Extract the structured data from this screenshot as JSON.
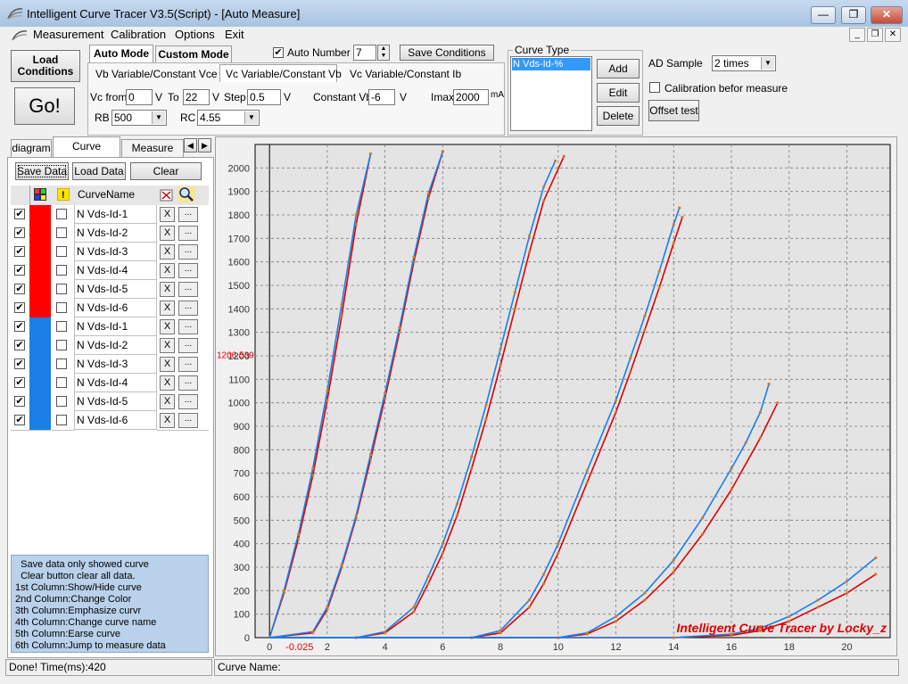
{
  "window": {
    "title": "Intelligent Curve Tracer V3.5(Script) - [Auto Measure]",
    "minimize": "—",
    "restore": "❐",
    "close": "✕"
  },
  "menu": {
    "items": [
      "Measurement",
      "Calibration",
      "Options",
      "Exit"
    ]
  },
  "toolbar": {
    "load_conditions": "Load\nConditions",
    "go": "Go!",
    "auto_mode": "Auto Mode",
    "custom_mode": "Custom Mode",
    "auto_number_label": "Auto Number",
    "auto_number_checked": true,
    "auto_number_value": "7",
    "save_conditions": "Save Conditions",
    "mode_tabs": [
      "Vb Variable/Constant Vce",
      "Vc Variable/Constant Vb",
      "Vc Variable/Constant Ib"
    ],
    "vc_from_label": "Vc from",
    "vc_from": "0",
    "to_label": "To",
    "to_value": "22",
    "step_label": "Step",
    "step_value": "0.5",
    "unit_v": "V",
    "constant_vb_label": "Constant Vb",
    "constant_vb": "-6",
    "imax_label": "Imax",
    "imax_value": "2000",
    "unit_ma": "mA",
    "rb_label": "RB",
    "rb_value": "500",
    "rc_label": "RC",
    "rc_value": "4.55"
  },
  "curve_type": {
    "group_label": "Curve Type",
    "items": [
      "N Vds-Id-%"
    ],
    "add": "Add",
    "edit": "Edit",
    "delete": "Delete"
  },
  "ad": {
    "label": "AD Sample",
    "value": "2 times",
    "calibration_label": "Calibration befor measure",
    "calibration_checked": false,
    "offset_test": "Offset test"
  },
  "left_tabs": [
    "diagram",
    "Curve Control",
    "Measure Data"
  ],
  "curve_control": {
    "save_data": "Save Data",
    "load_data": "Load Data",
    "clear": "Clear",
    "header_name": "CurveName",
    "rows": [
      {
        "name": "N Vds-Id-1",
        "color": "#ff0000",
        "shown": true
      },
      {
        "name": "N Vds-Id-2",
        "color": "#ff0000",
        "shown": true
      },
      {
        "name": "N Vds-Id-3",
        "color": "#ff0000",
        "shown": true
      },
      {
        "name": "N Vds-Id-4",
        "color": "#ff0000",
        "shown": true
      },
      {
        "name": "N Vds-Id-5",
        "color": "#ff0000",
        "shown": true
      },
      {
        "name": "N Vds-Id-6",
        "color": "#ff0000",
        "shown": true
      },
      {
        "name": "N Vds-Id-1",
        "color": "#1a7fe6",
        "shown": true
      },
      {
        "name": "N Vds-Id-2",
        "color": "#1a7fe6",
        "shown": true
      },
      {
        "name": "N Vds-Id-3",
        "color": "#1a7fe6",
        "shown": true
      },
      {
        "name": "N Vds-Id-4",
        "color": "#1a7fe6",
        "shown": true
      },
      {
        "name": "N Vds-Id-5",
        "color": "#1a7fe6",
        "shown": true
      },
      {
        "name": "N Vds-Id-6",
        "color": "#1a7fe6",
        "shown": true
      }
    ],
    "x_label": "X",
    "dots_label": "...",
    "help_lines": [
      "  Save data only showed curve",
      "  Clear button clear all data.",
      "1st Column:Show/Hide curve",
      "2nd Column:Change Color",
      "3th Column:Emphasize curvr",
      "4th Column:Change curve name",
      "5th Column:Earse curve",
      "6th Column:Jump to measure data"
    ]
  },
  "status": {
    "left": "Done!  Time(ms):420",
    "right": "Curve Name:"
  },
  "chart_data": {
    "type": "line",
    "xlim": [
      -0.5,
      21.5
    ],
    "ylim": [
      0,
      2100
    ],
    "xticks": [
      0,
      2,
      4,
      6,
      8,
      10,
      12,
      14,
      16,
      18,
      20
    ],
    "yticks": [
      0,
      100,
      200,
      300,
      400,
      500,
      600,
      700,
      800,
      900,
      1000,
      1100,
      1200,
      1300,
      1400,
      1500,
      1600,
      1700,
      1800,
      1900,
      2000
    ],
    "grid": true,
    "cursor_x_label": "-0.025",
    "cursor_y_label": "1206.539",
    "watermark": "Intelligent Curve Tracer by Locky_z",
    "series": [
      {
        "color": "#e00000",
        "x": [
          0,
          0.5,
          1,
          1.5,
          2,
          2.5,
          3,
          3.5
        ],
        "y": [
          0,
          190,
          420,
          690,
          1010,
          1370,
          1760,
          2060
        ]
      },
      {
        "color": "#e00000",
        "x": [
          0,
          1.5,
          2,
          2.5,
          3,
          3.5,
          4,
          4.5,
          5,
          5.5,
          6
        ],
        "y": [
          0,
          20,
          120,
          300,
          510,
          760,
          1020,
          1300,
          1600,
          1870,
          2070
        ]
      },
      {
        "color": "#e00000",
        "x": [
          0,
          3,
          4,
          5,
          5.5,
          6,
          6.5,
          7,
          7.5,
          8,
          8.5,
          9,
          9.5,
          10.2
        ],
        "y": [
          0,
          0,
          20,
          110,
          230,
          360,
          520,
          720,
          930,
          1160,
          1400,
          1640,
          1860,
          2050
        ]
      },
      {
        "color": "#e00000",
        "x": [
          0,
          7,
          8,
          9,
          9.5,
          10,
          11,
          12,
          12.5,
          13,
          13.5,
          14,
          14.3
        ],
        "y": [
          0,
          0,
          20,
          130,
          230,
          360,
          660,
          960,
          1130,
          1310,
          1490,
          1680,
          1790
        ]
      },
      {
        "color": "#e00000",
        "x": [
          0,
          10,
          11,
          12,
          13,
          14,
          15,
          16,
          17,
          17.6
        ],
        "y": [
          0,
          0,
          15,
          70,
          160,
          280,
          440,
          630,
          850,
          1000
        ]
      },
      {
        "color": "#e00000",
        "x": [
          0,
          14,
          16,
          17,
          18,
          19,
          20,
          21
        ],
        "y": [
          0,
          0,
          10,
          30,
          70,
          130,
          190,
          270
        ]
      },
      {
        "color": "#1a7fe6",
        "x": [
          0,
          0.5,
          1,
          1.5,
          2,
          2.5,
          3,
          3.5
        ],
        "y": [
          0,
          200,
          440,
          720,
          1050,
          1420,
          1800,
          2060
        ]
      },
      {
        "color": "#1a7fe6",
        "x": [
          0,
          1.5,
          2,
          2.5,
          3,
          3.5,
          4,
          4.5,
          5,
          5.5,
          6
        ],
        "y": [
          0,
          25,
          130,
          310,
          520,
          780,
          1040,
          1320,
          1620,
          1890,
          2070
        ]
      },
      {
        "color": "#1a7fe6",
        "x": [
          0,
          3,
          4,
          5,
          5.5,
          6,
          6.5,
          7,
          7.5,
          8,
          8.5,
          9,
          9.5,
          9.9
        ],
        "y": [
          0,
          0,
          25,
          130,
          260,
          400,
          570,
          770,
          990,
          1230,
          1470,
          1710,
          1920,
          2030
        ]
      },
      {
        "color": "#1a7fe6",
        "x": [
          0,
          7,
          8,
          9,
          9.5,
          10,
          11,
          12,
          12.5,
          13,
          13.5,
          14,
          14.2
        ],
        "y": [
          0,
          0,
          30,
          160,
          270,
          400,
          710,
          1010,
          1190,
          1370,
          1560,
          1760,
          1830
        ]
      },
      {
        "color": "#1a7fe6",
        "x": [
          0,
          10,
          11,
          12,
          13,
          14,
          15,
          16,
          16.5,
          17,
          17.3
        ],
        "y": [
          0,
          0,
          20,
          90,
          190,
          330,
          510,
          720,
          830,
          960,
          1080
        ]
      },
      {
        "color": "#1a7fe6",
        "x": [
          0,
          14,
          16,
          17,
          18,
          19,
          20,
          21
        ],
        "y": [
          0,
          0,
          15,
          40,
          90,
          160,
          240,
          340
        ]
      }
    ]
  }
}
